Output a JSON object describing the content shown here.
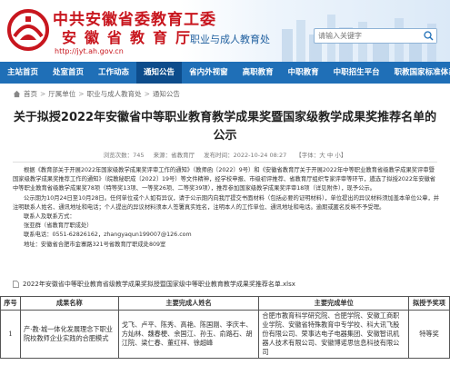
{
  "header": {
    "org_title": "中共安徽省委教育工委",
    "org_subtitle": "安徽省教育厅",
    "url": "http://jyt.ah.gov.cn",
    "section_name": "职业与成人教育处",
    "search_placeholder": "请输入关键字",
    "brand_color": "#c8161e"
  },
  "nav": {
    "items": [
      {
        "label": "主站首页",
        "active": false
      },
      {
        "label": "处室首页",
        "active": false
      },
      {
        "label": "工作动态",
        "active": false
      },
      {
        "label": "通知公告",
        "active": true
      },
      {
        "label": "省内外视窗",
        "active": false
      },
      {
        "label": "高职教育",
        "active": false
      },
      {
        "label": "中职教育",
        "active": false
      },
      {
        "label": "中职招生平台",
        "active": false
      },
      {
        "label": "职教国家标准体系",
        "active": false
      }
    ],
    "bg_color": "#1f6fb7"
  },
  "breadcrumb": {
    "items": [
      "首页",
      "厅属单位",
      "职业与成人教育处",
      "通知公告"
    ]
  },
  "article": {
    "title": "关于拟授2022年安徽省中等职业教育教学成果奖暨国家级教学成果奖推荐名单的公示",
    "meta": {
      "views": "浏览次数：745",
      "source": "来源：省教育厅",
      "date": "发布时间：2022-10-24 08:27",
      "font_size": "【字体：大 中 小】"
    },
    "paragraphs": [
      "根据《教育部关于开展2022年国家级教学成果奖评审工作的通知》（教师函〔2022〕9号）和《安徽省教育厅关于开展2022年中等职业教育省级教学成果奖评审暨国家级教学成果奖推荐工作的通知》（皖教秘职成〔2022〕19号）等文件精神，经学校申报、市级初评推荐、省教育厅组织专家评审等环节，遴选了拟授2022年安徽省中等职业教育省级教学成果奖78项（特等奖13项、一等奖26项、二等奖39项），推荐参加国家级教学成果奖评审18项（详见附件），现予公示。",
      "公示期为10月24日至10月28日。任何单位或个人如有异议，请于公示期内向我厅提交书面材料（包括必要的证明材料），单位提出的异议材料须加盖本单位公章，并注明联系人姓名、通讯地址和电话；个人提出的异议材料须本人签署真实姓名，注明本人的工作单位、通讯地址和电话。逾期或匿名反映不予受理。"
    ],
    "contact_heading": "联系人及联系方式：",
    "contact_lines": [
      "张亚群（省教育厅职成处）",
      "联系电话：0551-62826162，zhangyaqun199007@126.com",
      "地址：安徽省合肥市金寨路321号省教育厅职成处809室"
    ],
    "attachment_name": "2022年安徽省中等职业教育省级教学成果奖拟授暨国家级中等职业教育教学成果奖推荐名单.xlsx"
  },
  "table": {
    "headers": [
      "序号",
      "成果名称",
      "主要完成人姓名",
      "主要完成单位",
      "拟授予奖项"
    ],
    "rows": [
      {
        "no": "1",
        "name": "产·教·城一体化发展理念下职业院校教师企业实践的合肥模式",
        "members": "戈飞、卢平、陈秀、高艳、陈国刚、李庆丰、方灿林、魏春梗、余国江、孙玉、俞路石、胡江院、梁仁春、董红祥、徐超峰",
        "units": "合肥市教育科学研究院、合肥学院、安徽工商职业学院、安徽省特殊教育中专学校、科大讯飞股份有限公司、荣事达电子电器集团、安徽智讯机器人技术有限公司、安徽博诺思信息科技有限公司",
        "level": "特等奖"
      }
    ]
  }
}
